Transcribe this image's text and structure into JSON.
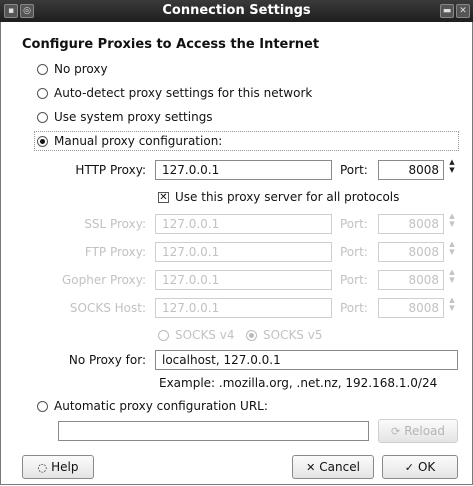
{
  "window": {
    "title": "Connection Settings"
  },
  "heading": "Configure Proxies to Access the Internet",
  "options": {
    "no_proxy": "No proxy",
    "auto_detect": "Auto-detect proxy settings for this network",
    "system": "Use system proxy settings",
    "manual": "Manual proxy configuration:",
    "auto_url": "Automatic proxy configuration URL:"
  },
  "selected_option": "manual",
  "http": {
    "label": "HTTP Proxy:",
    "value": "127.0.0.1",
    "port_label": "Port:",
    "port": "8008"
  },
  "use_for_all": {
    "label": "Use this proxy server for all protocols",
    "checked": true
  },
  "ssl": {
    "label": "SSL Proxy:",
    "value": "127.0.0.1",
    "port_label": "Port:",
    "port": "8008"
  },
  "ftp": {
    "label": "FTP Proxy:",
    "value": "127.0.0.1",
    "port_label": "Port:",
    "port": "8008"
  },
  "gopher": {
    "label": "Gopher Proxy:",
    "value": "127.0.0.1",
    "port_label": "Port:",
    "port": "8008"
  },
  "socks": {
    "label": "SOCKS Host:",
    "value": "127.0.0.1",
    "port_label": "Port:",
    "port": "8008"
  },
  "socks_version": {
    "v4": "SOCKS v4",
    "v5": "SOCKS v5",
    "selected": "v5"
  },
  "no_proxy_for": {
    "label": "No Proxy for:",
    "value": "localhost, 127.0.0.1"
  },
  "example": "Example: .mozilla.org, .net.nz, 192.168.1.0/24",
  "auto_url_value": "",
  "buttons": {
    "reload": "Reload",
    "help": "Help",
    "cancel": "Cancel",
    "ok": "OK"
  },
  "colors": {
    "titlebar": "#2a2a2a",
    "disabled_text": "#c2c2c2"
  }
}
